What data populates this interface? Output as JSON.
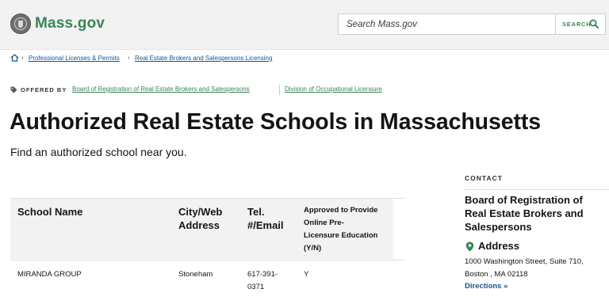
{
  "header": {
    "logo_text": "Mass.gov",
    "search": {
      "placeholder": "Search Mass.gov",
      "button_label": "SEARCH"
    }
  },
  "breadcrumb": {
    "items": [
      {
        "label": "Professional Licenses & Permits"
      },
      {
        "label": "Real Estate Brokers and Salespersons Licensing"
      }
    ]
  },
  "offered_by": {
    "label": "OFFERED BY",
    "links": [
      {
        "label": "Board of Registration of Real Estate Brokers and Salespersons"
      },
      {
        "label": "Division of Occupational Licensure"
      }
    ]
  },
  "main": {
    "title": "Authorized Real Estate Schools in Massachusetts",
    "subtitle": "Find an authorized school near you."
  },
  "table": {
    "headers": {
      "school_name": "School Name",
      "city_web_line1": "City/Web",
      "city_web_line2": "Address",
      "tel_line1": "Tel.",
      "tel_line2": "#/Email",
      "approved_line1": "Approved to Provide",
      "approved_line2": "Online Pre-",
      "approved_line3": "Licensure Education",
      "approved_line4": "(Y/N)"
    },
    "rows": [
      {
        "school_name": "MIRANDA GROUP",
        "city": "Stoneham",
        "tel_line1": "617-391-",
        "tel_line2": "0371",
        "approved": "Y"
      }
    ]
  },
  "contact": {
    "label": "CONTACT",
    "org_line1": "Board of Registration of",
    "org_line2": "Real Estate Brokers and",
    "org_line3": "Salespersons",
    "address_label": "Address",
    "address_line1": "1000 Washington Street, Suite 710,",
    "address_line2": "Boston , MA 02118",
    "directions_label": "Directions",
    "directions_arrow": "»"
  },
  "colors": {
    "brand_green": "#388557",
    "link_blue": "#14558f",
    "header_bg": "#f2f2f2"
  },
  "icons": [
    "seal-logo-icon",
    "search-icon",
    "home-icon",
    "chevron-right-icon",
    "tag-icon",
    "map-pin-icon"
  ]
}
